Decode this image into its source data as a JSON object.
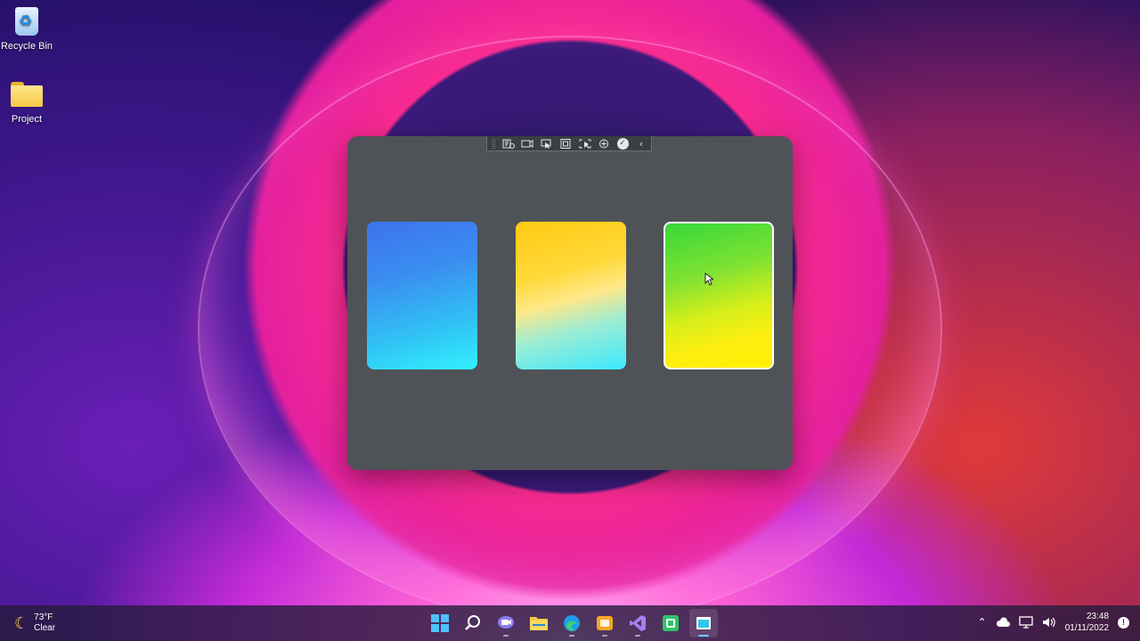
{
  "desktop": {
    "icons": [
      {
        "label": "Recycle Bin"
      },
      {
        "label": "Project"
      }
    ]
  },
  "app_window": {
    "toolbar": {
      "icons": [
        "live-visual-tree-icon",
        "record-icon",
        "select-element-icon",
        "display-layout-adorners-icon",
        "track-focus-icon",
        "binding-failures-icon",
        "hot-reload-check-icon",
        "collapse-chevron-icon"
      ]
    },
    "cards": [
      {
        "name": "blue-card",
        "colors": [
          "#3e73ee",
          "#33f0ff"
        ]
      },
      {
        "name": "yellow-card",
        "colors": [
          "#ffca12",
          "#3ae9ff"
        ]
      },
      {
        "name": "green-card",
        "colors": [
          "#36d83a",
          "#fff000"
        ],
        "selected": true
      }
    ],
    "background": "#4f5358"
  },
  "taskbar": {
    "weather": {
      "temp": "73°F",
      "condition": "Clear"
    },
    "apps": [
      "start-icon",
      "search-icon",
      "chat-icon",
      "file-explorer-icon",
      "edge-icon",
      "app-icon",
      "visual-studio-icon",
      "android-icon",
      "active-app-icon"
    ],
    "clock": {
      "time": "23:48",
      "date": "01/11/2022"
    },
    "notification_count": "!"
  }
}
